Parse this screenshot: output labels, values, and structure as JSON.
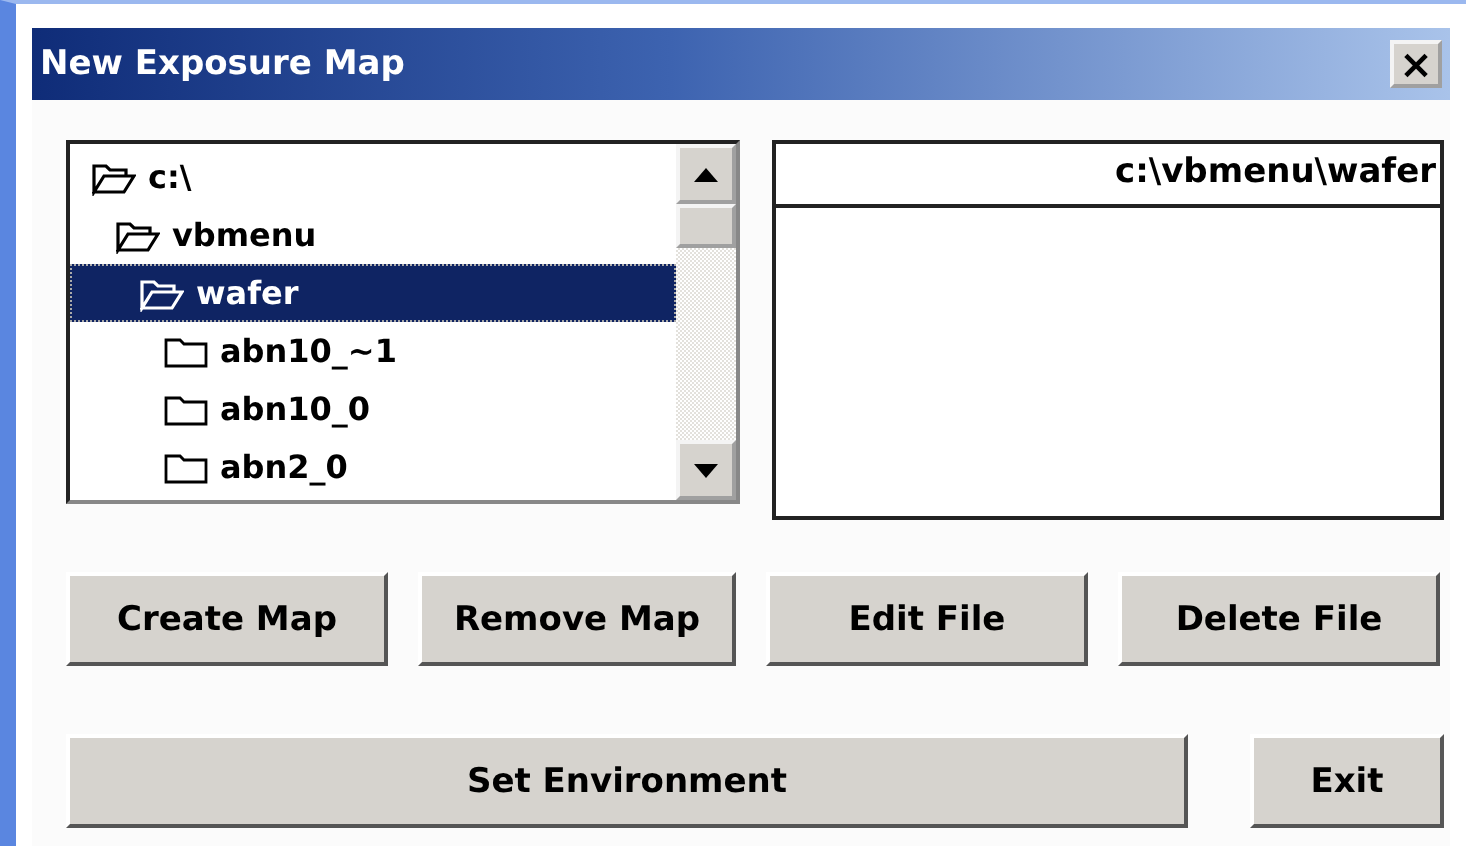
{
  "window": {
    "title": "New Exposure Map",
    "close": "×"
  },
  "tree": [
    {
      "label": "c:\\",
      "expanded": true,
      "selected": false,
      "children": [
        {
          "label": "vbmenu",
          "expanded": true,
          "selected": false,
          "children": [
            {
              "label": "wafer",
              "expanded": true,
              "selected": true,
              "children": [
                {
                  "label": "abn10_~1",
                  "expanded": false,
                  "selected": false
                },
                {
                  "label": "abn10_0",
                  "expanded": false,
                  "selected": false
                },
                {
                  "label": "abn2_0",
                  "expanded": false,
                  "selected": false
                }
              ]
            }
          ]
        }
      ]
    }
  ],
  "file_list": {
    "path": "c:\\vbmenu\\wafer"
  },
  "buttons": [
    "Create Map",
    "Remove Map",
    "Edit File",
    "Delete File"
  ],
  "bottom_buttons": [
    "Set Environment",
    "Exit"
  ]
}
